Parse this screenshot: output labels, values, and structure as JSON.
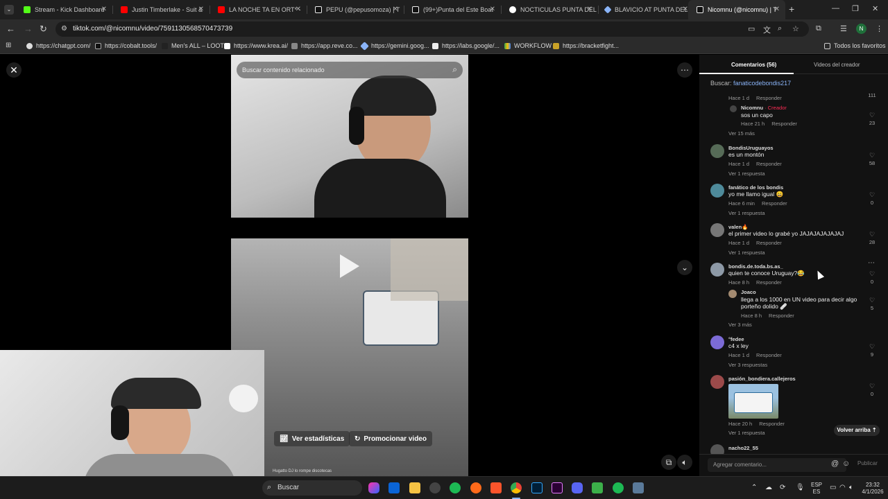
{
  "tabs": [
    {
      "title": "Stream - Kick Dashboard",
      "color": "#53fc18"
    },
    {
      "title": "Justin Timberlake - Suit &",
      "color": "#ff0000"
    },
    {
      "title": "LA NOCHE TA EN ORT* -",
      "color": "#ff0000"
    },
    {
      "title": "PEPU (@pepusomoza) | T",
      "color": "#ffffff"
    },
    {
      "title": "(99+)Punta del Este Boat",
      "color": "#ffffff"
    },
    {
      "title": "NOCTICULAS PUNTA DEL",
      "color": "#4285f4"
    },
    {
      "title": "BLAVICIO AT PUNTA DEL",
      "color": "#8ab4f8"
    },
    {
      "title": "Nicomnu (@nicomnu) | T",
      "color": "#ffffff"
    }
  ],
  "address": {
    "url": "tiktok.com/@nicomnu/video/7591130568570473739"
  },
  "bookmarks": [
    "https://chatgpt.com/",
    "https://cobalt.tools/",
    "Men's ALL – LOOT",
    "https://www.krea.ai/",
    "https://app.reve.co...",
    "https://gemini.goog...",
    "https://labs.google/...",
    "WORKFLOW",
    "https://bracketfight..."
  ],
  "bookmarks_all": "Todos los favoritos",
  "video": {
    "search_placeholder": "Buscar contenido relacionado",
    "stats_button": "Ver estadísticas",
    "promote_button": "Promocionar video",
    "caption": "Hugatto DJ lo rompe discotecas"
  },
  "panel": {
    "tab_comments": "Comentarios (56)",
    "tab_creator_videos": "Videos del creador",
    "search_label": "Buscar:",
    "search_query": "fanaticodebondis217",
    "reply_label": "Responder",
    "back_to_top": "Volver arriba",
    "comment_placeholder": "Agregar comentario...",
    "publish": "Publicar",
    "comments": [
      {
        "meta": "Hace 1 d",
        "likes": "111"
      },
      {
        "user": "Nicomnu",
        "creator": "· Creador",
        "text": "sos un capo",
        "meta": "Hace 21 h",
        "likes": "23"
      },
      {
        "more": "Ver 15 más"
      },
      {
        "user": "BondisUruguayos",
        "text": "es un montón",
        "meta": "Hace 1 d",
        "likes": "58",
        "more": "Ver 1 respuesta"
      },
      {
        "user": "fanático de los bondis",
        "text": "yo me llamo igual 😄",
        "meta": "Hace 6 min",
        "likes": "0",
        "more": "Ver 1 respuesta"
      },
      {
        "user": "valen🔥",
        "text": "el primer video lo grabé yo JAJAJAJAJAJAJ",
        "meta": "Hace 1 d",
        "likes": "28",
        "more": "Ver 1 respuesta"
      },
      {
        "user": "bondis.de.toda.bs.as_",
        "text": "quien te conoce Uruguay?😂",
        "meta": "Hace 8 h",
        "likes": "0"
      },
      {
        "user": "Joaco",
        "text": "llega a los 1000 en UN video para decir algo",
        "text2": "porteño dolido 🩹",
        "meta": "Hace 8 h",
        "likes": "5",
        "more": "Ver 3 más"
      },
      {
        "user": "°fedee",
        "text": "c4 x ley",
        "meta": "Hace 1 d",
        "likes": "9",
        "more": "Ver 3 respuestas"
      },
      {
        "user": "pasión_bondiera.callejeros",
        "meta": "Hace 20 h",
        "likes": "0",
        "more": "Ver 1 respuesta"
      },
      {
        "user": "nacho22_55"
      }
    ]
  },
  "taskbar": {
    "search": "Buscar",
    "lang": "ESP",
    "lang2": "ES",
    "time": "23:32",
    "date": "4/1/2026"
  }
}
